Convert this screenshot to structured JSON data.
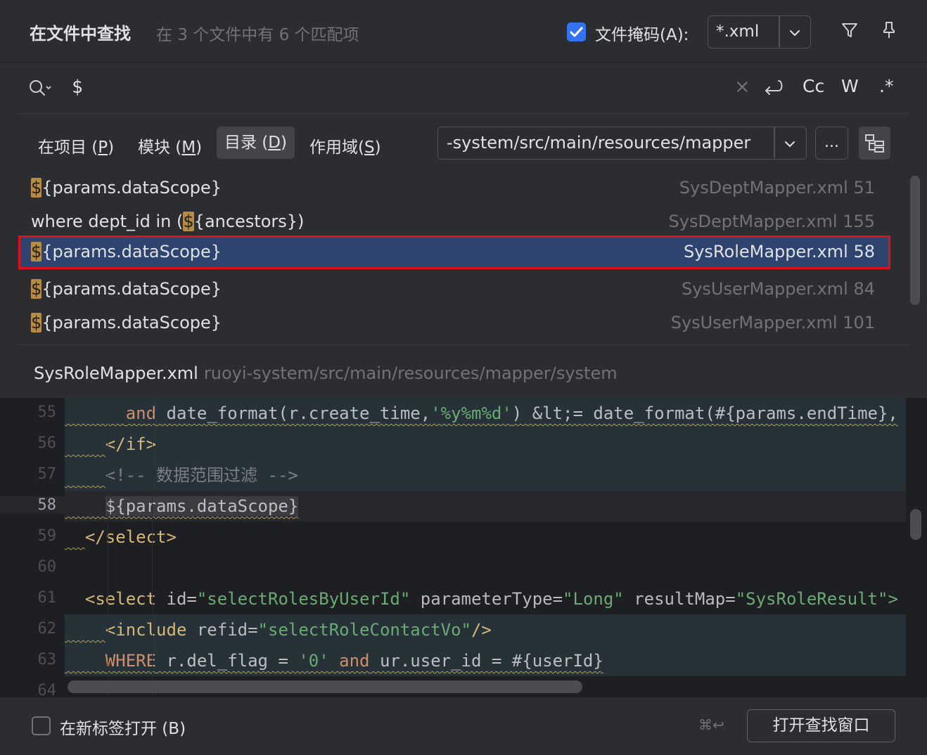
{
  "header": {
    "title": "在文件中查找",
    "subtitle": "在 3 个文件中有 6 个匹配项",
    "file_mask_checked": true,
    "file_mask_label": "文件掩码(A):",
    "file_mask_value": "*.xml"
  },
  "search": {
    "query": "$",
    "options": {
      "clear": "×",
      "case": "Cc",
      "words": "W",
      "regex": ".*"
    }
  },
  "scopes": {
    "project": {
      "prefix": "在项目 (",
      "key": "P",
      "suffix": ")"
    },
    "module": {
      "prefix": "模块 (",
      "key": "M",
      "suffix": ")"
    },
    "directory": {
      "prefix": "目录 (",
      "key": "D",
      "suffix": ")"
    },
    "scope": {
      "prefix": "作用域(",
      "key": "S",
      "suffix": ")"
    },
    "active": "directory",
    "directory_path": "-system/src/main/resources/mapper",
    "browse_label": "..."
  },
  "results": [
    {
      "pre": "",
      "match": "$",
      "post": "{params.dataScope}",
      "file": "SysDeptMapper.xml 51",
      "selected": false
    },
    {
      "pre": "where dept_id in (",
      "match": "$",
      "post": "{ancestors})",
      "file": "SysDeptMapper.xml 155",
      "selected": false
    },
    {
      "pre": "",
      "match": "$",
      "post": "{params.dataScope}",
      "file": "SysRoleMapper.xml 58",
      "selected": true
    },
    {
      "pre": "",
      "match": "$",
      "post": "{params.dataScope}",
      "file": "SysUserMapper.xml 84",
      "selected": false
    },
    {
      "pre": "",
      "match": "$",
      "post": "{params.dataScope}",
      "file": "SysUserMapper.xml 101",
      "selected": false
    }
  ],
  "preview": {
    "file_name": "SysRoleMapper.xml",
    "file_path": "ruoyi-system/src/main/resources/mapper/system",
    "line_numbers": [
      "55",
      "56",
      "57",
      "58",
      "59",
      "60",
      "61",
      "62",
      "63",
      "64"
    ],
    "current_line": "58",
    "code": {
      "l55_indent": "      ",
      "l55_and": "and",
      "l55_rest1": " date_format(r.create_time,",
      "l55_str": "'%y%m%d'",
      "l55_rest2": ") &lt;= date_format(#{params.endTime},",
      "l56_indent": "    ",
      "l56_tag": "</if>",
      "l57_indent": "    ",
      "l57_comment": "<!-- 数据范围过滤 -->",
      "l58_indent": "    ",
      "l58_code": "${params.dataScope}",
      "l59_indent": "  ",
      "l59_tag": "</select>",
      "l61_indent": "  ",
      "l61_tag_open": "<select ",
      "l61_attr1": "id=",
      "l61_val1": "\"selectRolesByUserId\"",
      "l61_attr2": " parameterType=",
      "l61_val2": "\"Long\"",
      "l61_attr3": " resultMap=",
      "l61_val3": "\"SysRoleResult\">",
      "l62_indent": "    ",
      "l62_tag_open": "<include ",
      "l62_attr": "refid=",
      "l62_val": "\"selectRoleContactVo\"",
      "l62_close": "/>",
      "l63_indent": "    ",
      "l63_kw1": "WHERE",
      "l63_mid1": " r.del_flag = ",
      "l63_str": "'0'",
      "l63_kw2": " and",
      "l63_mid2": " ur.user_id = #{userId}"
    }
  },
  "footer": {
    "open_in_new_tab_checked": false,
    "open_in_new_tab_label": "在新标签打开 (B)",
    "shortcut": "⌘↩",
    "open_find_window_label": "打开查找窗口"
  }
}
